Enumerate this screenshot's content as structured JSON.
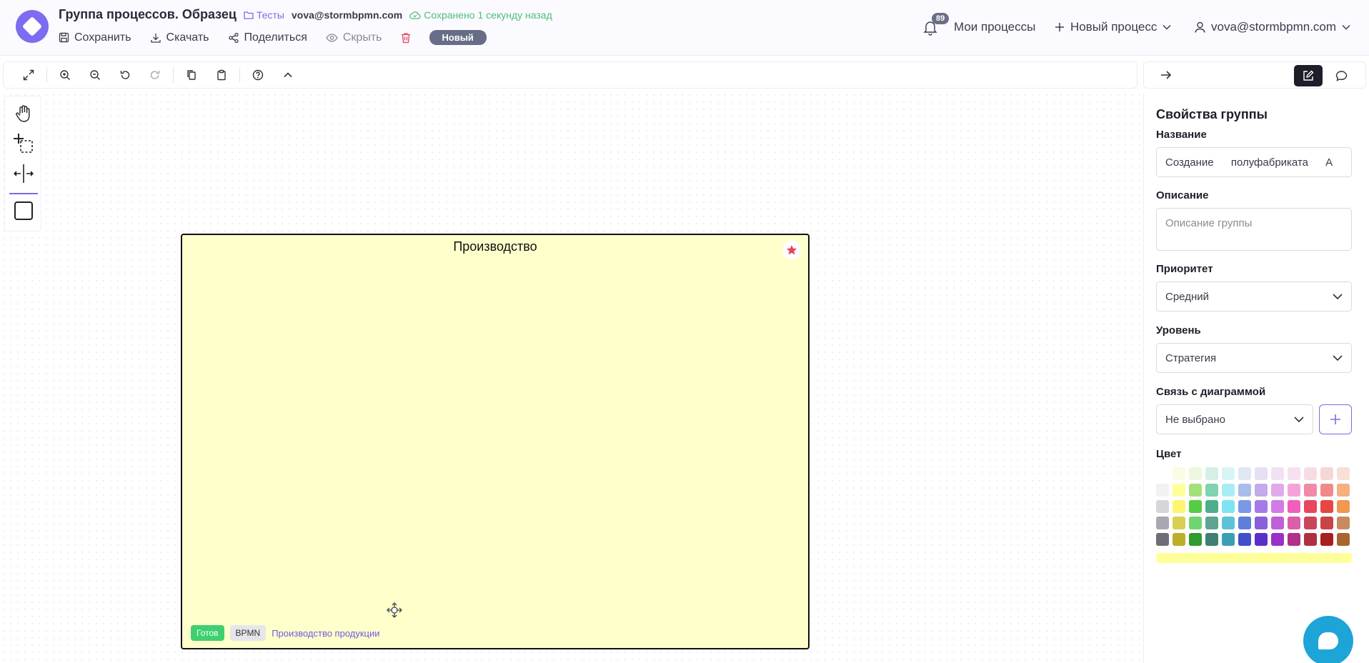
{
  "header": {
    "title": "Группа процессов. Образец",
    "folder": "Тесты",
    "owner": "vova@stormbpmn.com",
    "saved_status": "Сохранено 1 секунду назад",
    "actions": {
      "save": "Сохранить",
      "download": "Скачать",
      "share": "Поделиться",
      "hide": "Скрыть"
    },
    "status_badge": "Новый",
    "notifications_count": "89",
    "my_processes": "Мои процессы",
    "new_process": "Новый процесс",
    "user": "vova@stormbpmn.com"
  },
  "canvas": {
    "group": {
      "title": "Производство",
      "tag_ready": "Готов",
      "tag_type": "BPMN",
      "link_text": "Производство продукции",
      "fill_color": "#ffffcc"
    }
  },
  "panel": {
    "heading": "Свойства группы",
    "name_label": "Название",
    "name_value": "Создание полуфабриката А",
    "description_label": "Описание",
    "description_placeholder": "Описание группы",
    "priority_label": "Приоритет",
    "priority_value": "Средний",
    "level_label": "Уровень",
    "level_value": "Стратегия",
    "link_label": "Связь с диаграммой",
    "link_value": "Не выбрано",
    "color_label": "Цвет",
    "selected_color": "#ffff99",
    "palette": [
      "#ffffff",
      "#fbfbe6",
      "#eef7e0",
      "#d6efe6",
      "#d9f4f7",
      "#dfe6f4",
      "#e6e0f4",
      "#f2e0f4",
      "#f7e0f0",
      "#f7dce6",
      "#f7d6d6",
      "#f7e0d6",
      "#f2f2f4",
      "#ffff99",
      "#a3e07a",
      "#7fd3b0",
      "#a8ecf4",
      "#a9bcec",
      "#c4a9ec",
      "#e0a9ec",
      "#f4a3d8",
      "#f08aa8",
      "#f08a8a",
      "#f4b07f",
      "#d6d6da",
      "#fff56e",
      "#55cc44",
      "#4cae8a",
      "#7ee4f4",
      "#7a97e8",
      "#a47ae8",
      "#d27ae8",
      "#f05fbc",
      "#e8455f",
      "#e84545",
      "#f0984f",
      "#a8a8b0",
      "#d9cf54",
      "#6fd66f",
      "#5fa392",
      "#5cc2d6",
      "#5d7fd9",
      "#8a5fd9",
      "#bf5fd9",
      "#d95fa8",
      "#c9455a",
      "#c94545",
      "#c98a5f",
      "#6e6e78",
      "#bdae2a",
      "#2f9a2f",
      "#3f7f74",
      "#3a9fb5",
      "#3f50c9",
      "#5a2fc9",
      "#9a2fc9",
      "#b02f8a",
      "#b02f45",
      "#a81f1f",
      "#a8652f"
    ]
  },
  "icons": [
    "logo-icon",
    "folder-icon",
    "cloud-check-icon",
    "save-icon",
    "download-icon",
    "share-icon",
    "eye-icon",
    "trash-icon",
    "bell-icon",
    "plus-icon",
    "user-icon",
    "chevron-down-icon",
    "expand-icon",
    "zoom-in-icon",
    "zoom-out-icon",
    "undo-icon",
    "redo-icon",
    "copy-icon",
    "paste-icon",
    "help-icon",
    "chevron-up-icon",
    "arrow-right-icon",
    "edit-icon",
    "comment-icon",
    "hand-icon",
    "lasso-icon",
    "space-icon",
    "frame-icon",
    "star-icon",
    "move-icon",
    "chat-icon"
  ]
}
